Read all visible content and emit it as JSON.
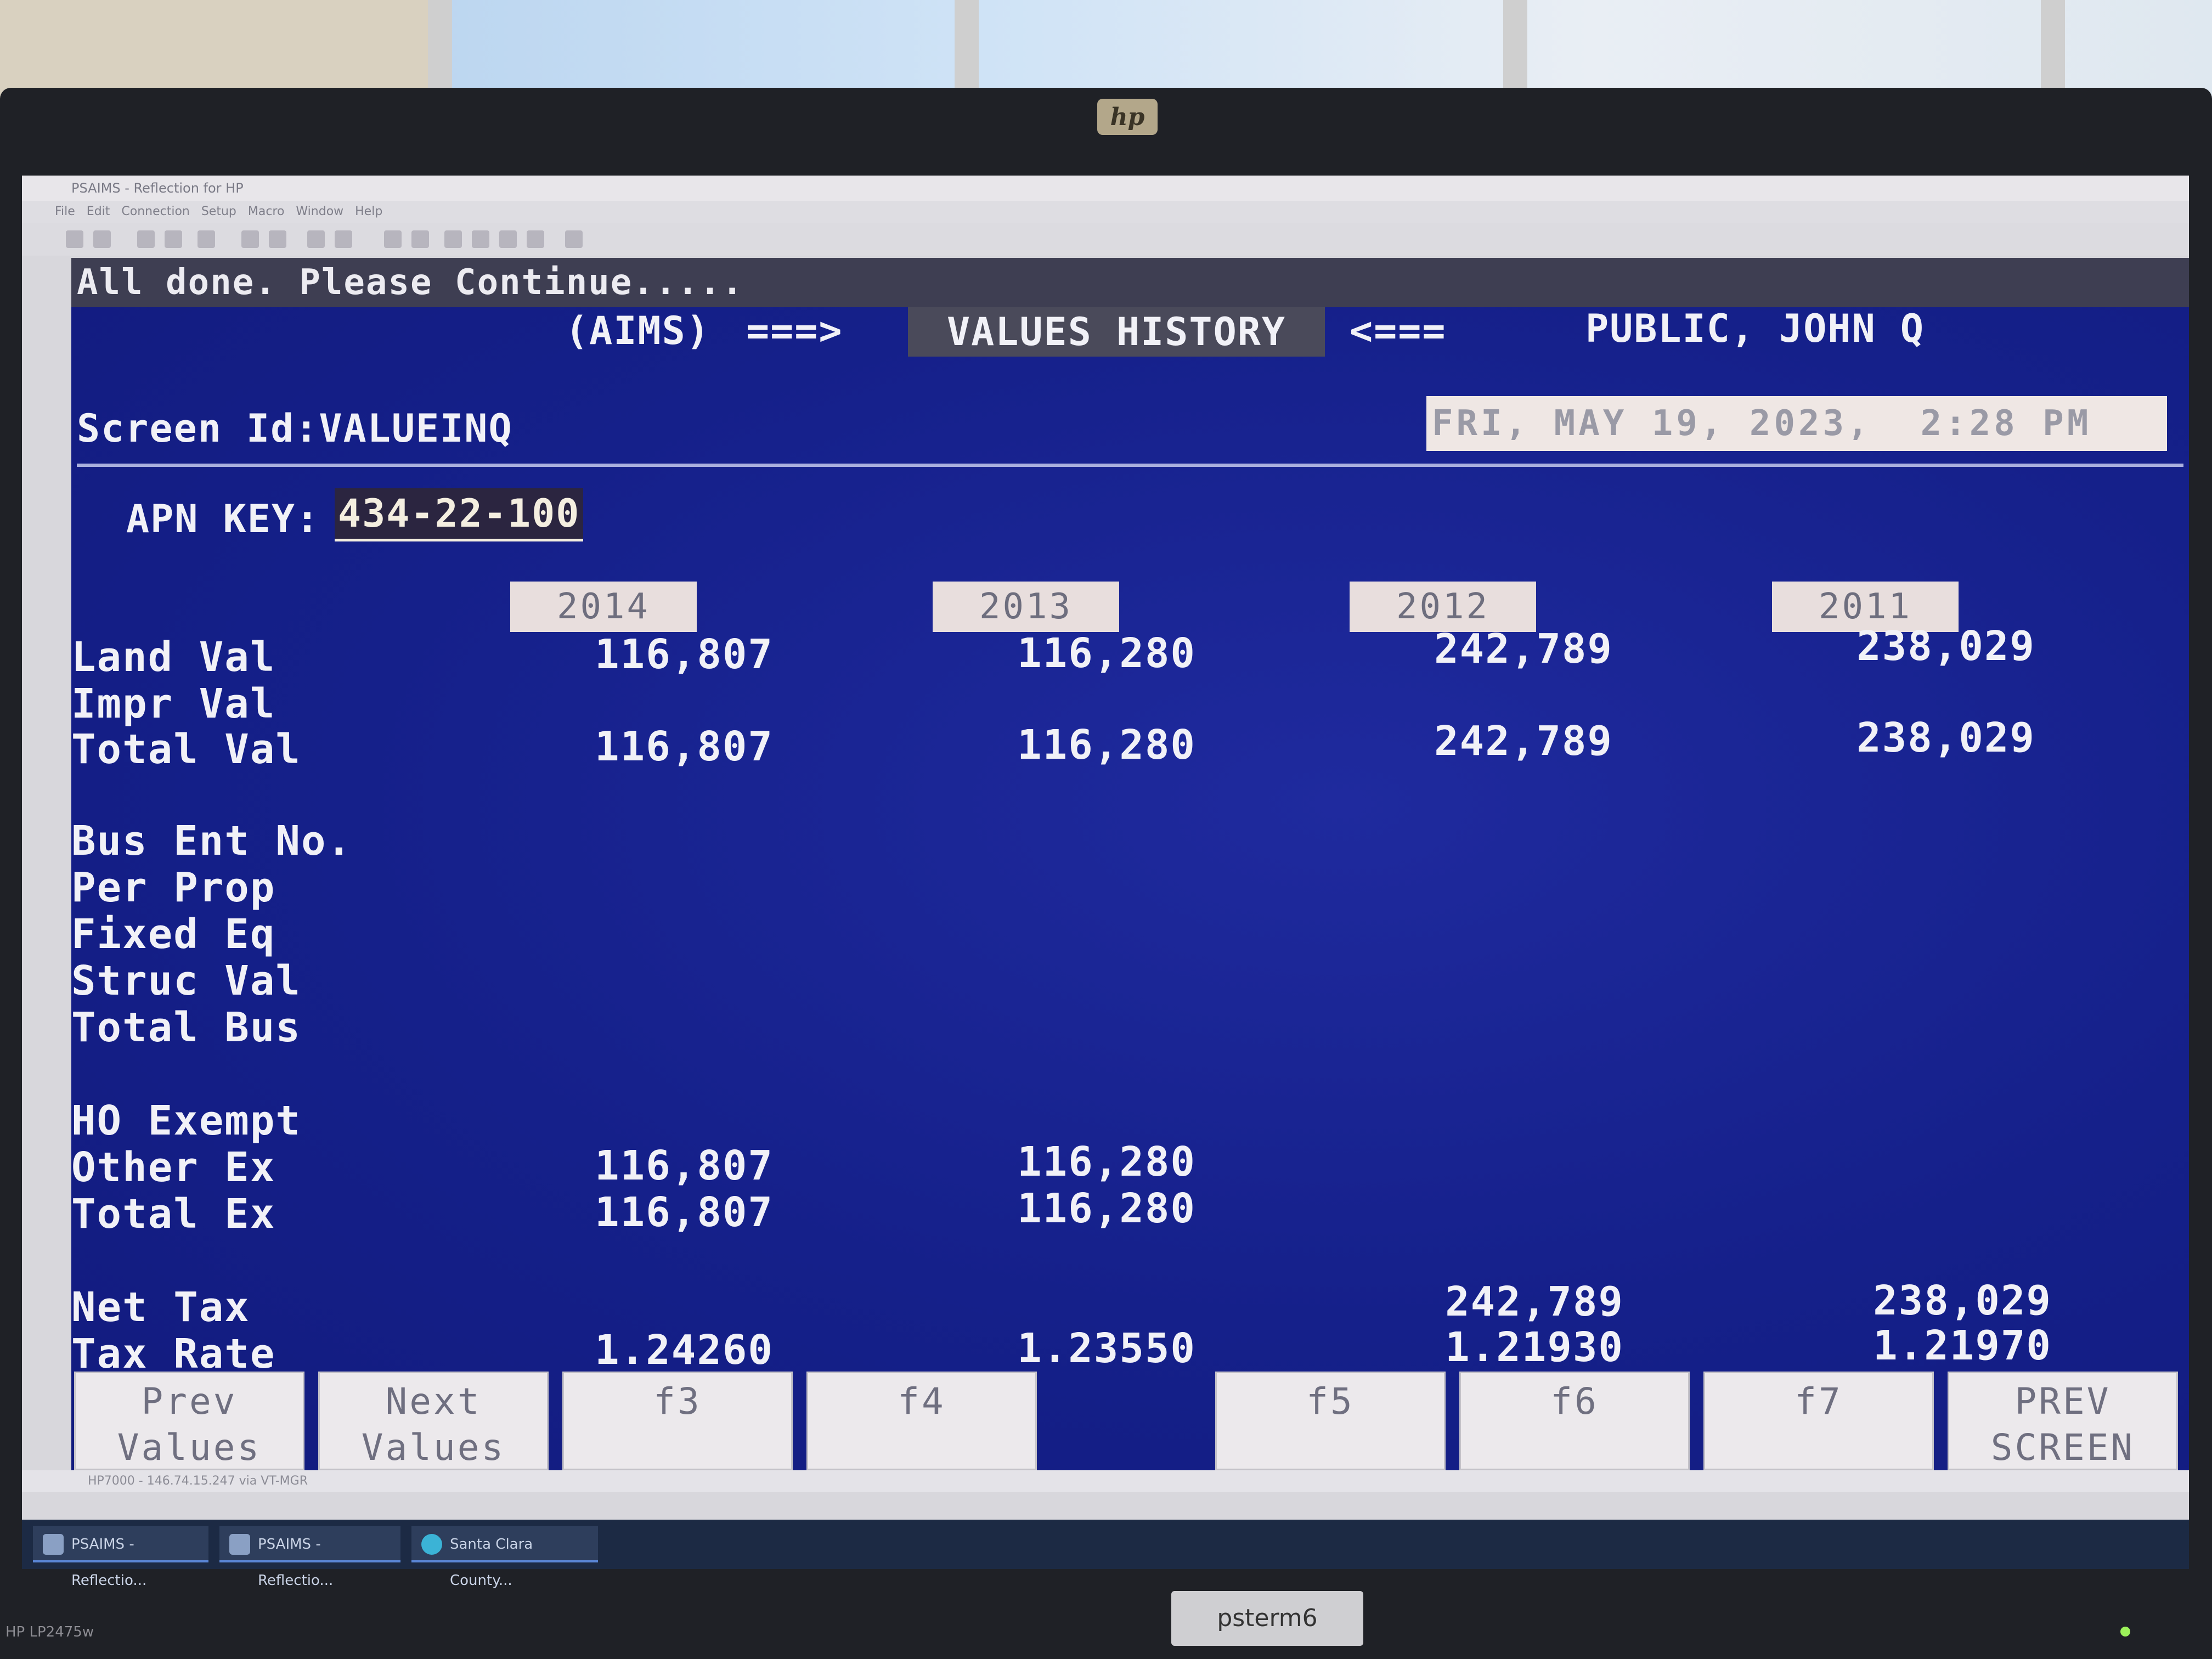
{
  "monitor": {
    "brand_logo": "hp",
    "model": "HP LP2475w",
    "sticker": "psterm6"
  },
  "app": {
    "title": "PSAIMS - Reflection for HP",
    "menu": "File   Edit   Connection   Setup   Macro   Window   Help",
    "statusline": "HP7000 - 146.74.15.247 via VT-MGR"
  },
  "terminal": {
    "status_message": "All done.  Please Continue.....",
    "system": "(AIMS)",
    "arrow_right": "===>",
    "screen_title": "VALUES HISTORY",
    "arrow_left": "<===",
    "owner_name": "PUBLIC, JOHN Q",
    "screen_id": "Screen Id:VALUEINQ",
    "datetime": "FRI, MAY 19, 2023,  2:28 PM",
    "apn_label": "APN KEY:",
    "apn_value": "434-22-100",
    "years": [
      "2014",
      "2013",
      "2012",
      "2011"
    ],
    "rows": {
      "land_val": {
        "label": "Land Val",
        "values": [
          "116,807",
          "116,280",
          "242,789",
          "238,029"
        ]
      },
      "impr_val": {
        "label": "Impr Val",
        "values": [
          "",
          "",
          "",
          ""
        ]
      },
      "total_val": {
        "label": "Total Val",
        "values": [
          "116,807",
          "116,280",
          "242,789",
          "238,029"
        ]
      },
      "bus_ent_no": {
        "label": "Bus Ent No.",
        "values": [
          "",
          "",
          "",
          ""
        ]
      },
      "per_prop": {
        "label": "Per Prop",
        "values": [
          "",
          "",
          "",
          ""
        ]
      },
      "fixed_eq": {
        "label": "Fixed Eq",
        "values": [
          "",
          "",
          "",
          ""
        ]
      },
      "struc_val": {
        "label": "Struc Val",
        "values": [
          "",
          "",
          "",
          ""
        ]
      },
      "total_bus": {
        "label": "Total Bus",
        "values": [
          "",
          "",
          "",
          ""
        ]
      },
      "ho_exempt": {
        "label": "HO Exempt",
        "values": [
          "",
          "",
          "",
          ""
        ]
      },
      "other_ex": {
        "label": "Other Ex",
        "values": [
          "116,807",
          "116,280",
          "",
          ""
        ]
      },
      "total_ex": {
        "label": "Total Ex",
        "values": [
          "116,807",
          "116,280",
          "",
          ""
        ]
      },
      "net_tax": {
        "label": "Net Tax",
        "values": [
          "",
          "",
          "242,789",
          "238,029"
        ]
      },
      "tax_rate": {
        "label": "Tax Rate",
        "values": [
          "1.24260",
          "1.23550",
          "1.21930",
          "1.21970"
        ]
      }
    },
    "function_keys": [
      "Prev\nValues",
      "Next\nValues",
      "f3",
      "f4",
      "f5",
      "f6",
      "f7",
      "PREV\nSCREEN"
    ]
  },
  "taskbar": {
    "items": [
      "PSAIMS - Reflectio...",
      "PSAIMS - Reflectio...",
      "Santa Clara County..."
    ]
  }
}
